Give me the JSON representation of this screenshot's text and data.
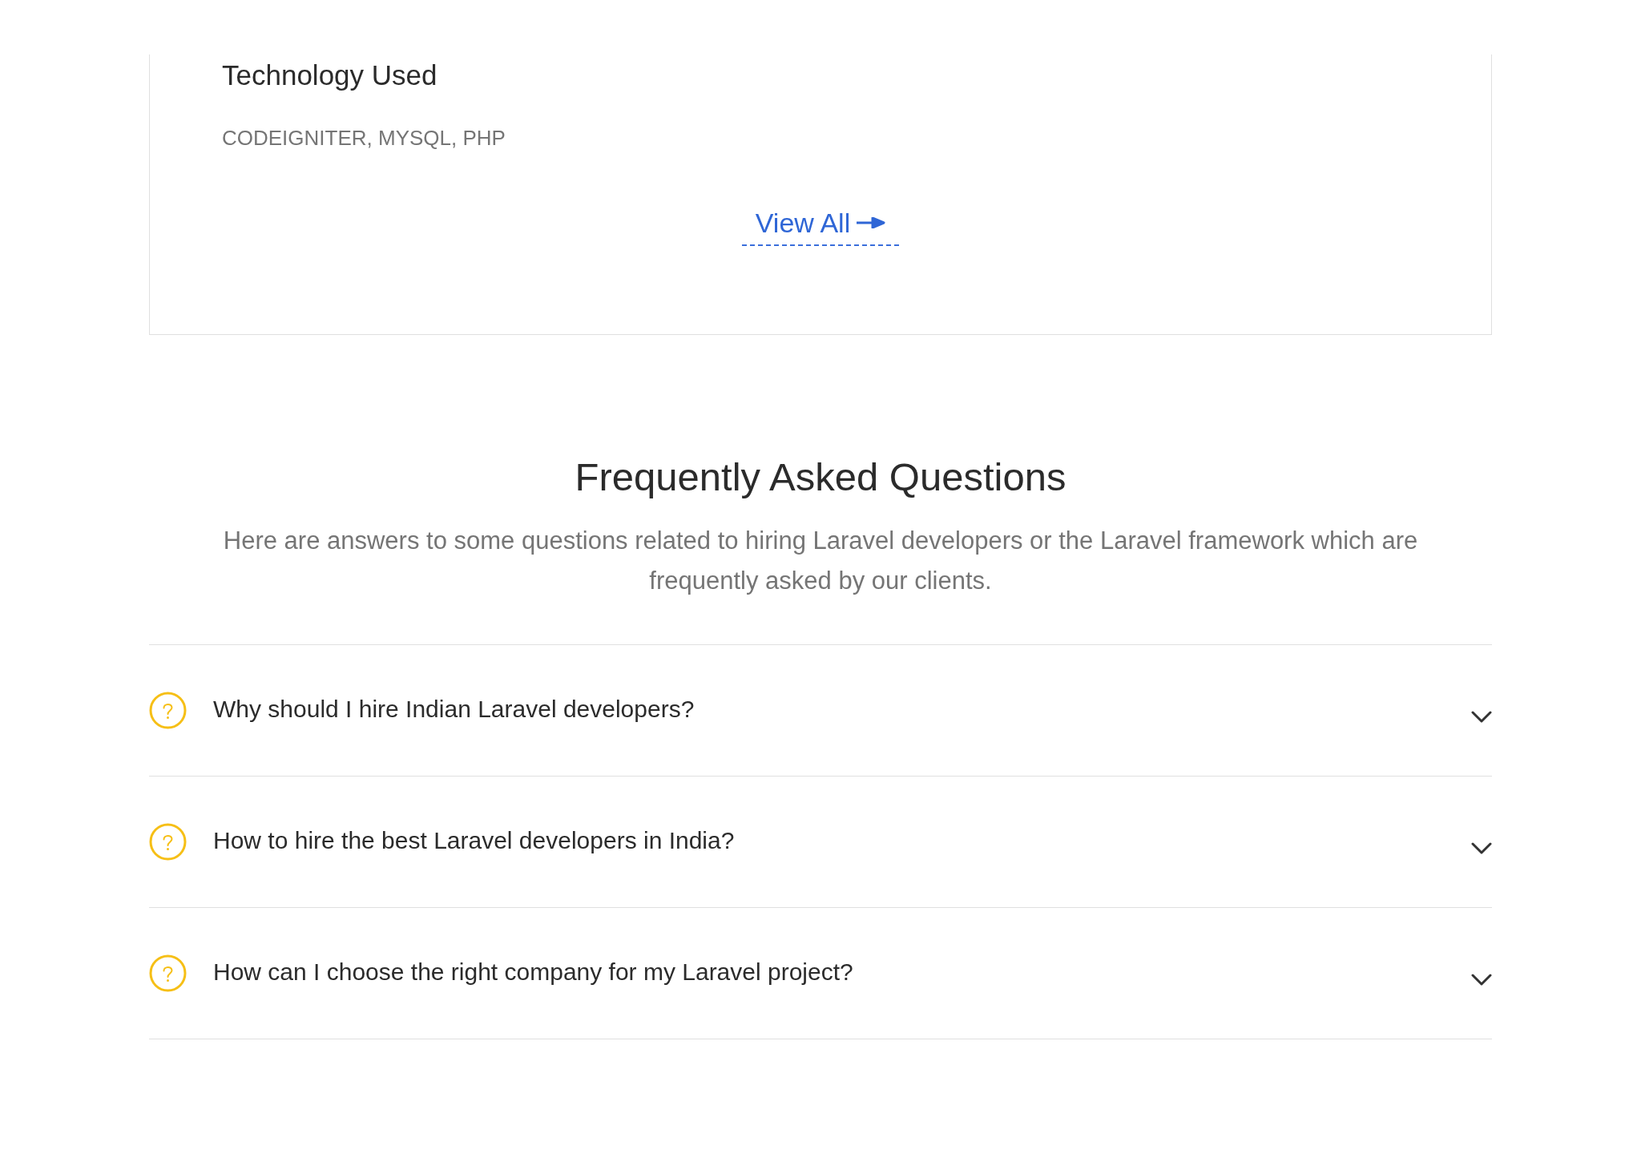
{
  "project_card": {
    "technology_heading": "Technology Used",
    "technologies": "CODEIGNITER, MYSQL, PHP",
    "view_all_link": "View All"
  },
  "faq": {
    "title": "Frequently Asked Questions",
    "intro": "Here are answers to some questions related to hiring Laravel developers or the Laravel framework which are frequently asked by our clients.",
    "questions": [
      {
        "question": "Why should I hire Indian Laravel developers?",
        "expanded": false
      },
      {
        "question": "How to hire the best Laravel developers in India?",
        "expanded": false
      },
      {
        "question": "How can I choose the right company for my Laravel project?",
        "expanded": false
      }
    ]
  }
}
